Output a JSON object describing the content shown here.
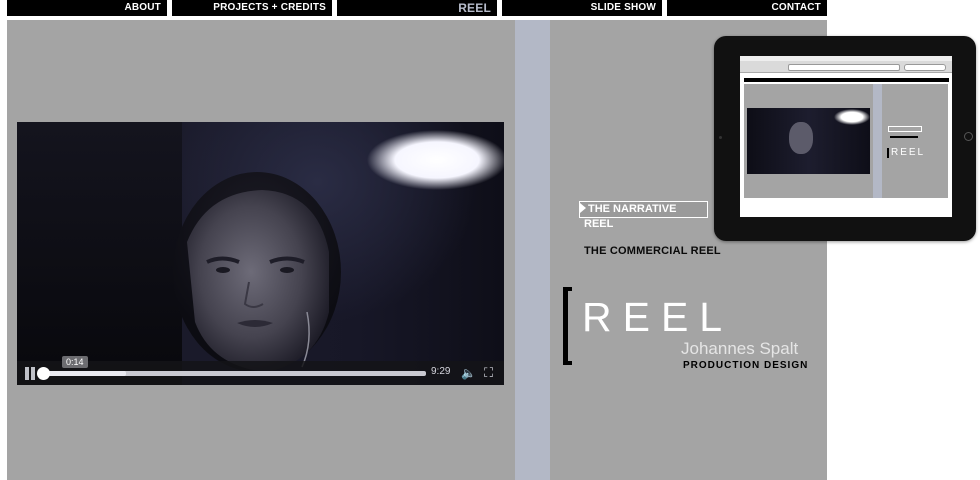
{
  "nav": {
    "items": [
      {
        "label": "ABOUT"
      },
      {
        "label": "PROJECTS + CREDITS"
      },
      {
        "label": "REEL"
      },
      {
        "label": "SLIDE SHOW"
      },
      {
        "label": "CONTACT"
      }
    ],
    "active": "REEL"
  },
  "video": {
    "current_time": "0:14",
    "duration": "9:29",
    "progress": 0.22
  },
  "reels": {
    "narrative": "THE NARRATIVE REEL",
    "commercial": "THE COMMERCIAL REEL"
  },
  "logo": {
    "title": "REEL",
    "name": "Johannes Spalt",
    "subtitle": "PRODUCTION DESIGN"
  },
  "colors": {
    "background_panel": "#a4a4a4",
    "divider": "#b3b8c6",
    "nav_bg": "#000000",
    "nav_active_text": "#b7bccb"
  },
  "icons": [
    "pause-icon",
    "volume-icon",
    "fullscreen-icon",
    "play-triangle-icon"
  ]
}
